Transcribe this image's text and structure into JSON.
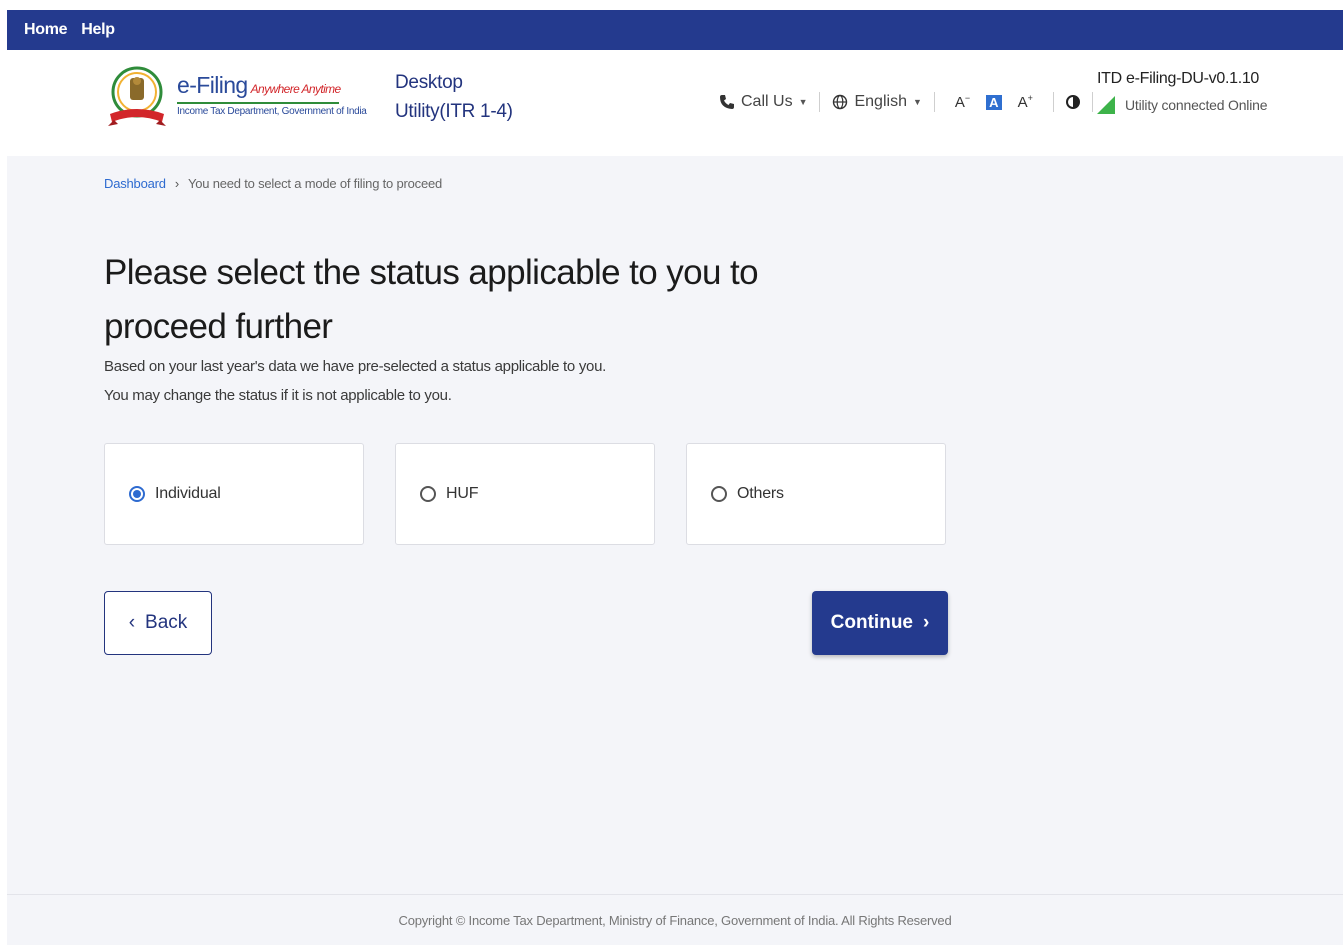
{
  "topnav": {
    "home": "Home",
    "help": "Help"
  },
  "header": {
    "logo_title": "e-Filing",
    "logo_tagline": "Anywhere Anytime",
    "logo_subtitle": "Income Tax Department, Government of India",
    "utility_line1": "Desktop",
    "utility_line2": "Utility(ITR 1-4)",
    "call_us": "Call Us",
    "language": "English",
    "font_decrease": "A",
    "font_normal": "A",
    "font_increase": "A",
    "version": "ITD e-Filing-DU-v0.1.10",
    "connection_status": "Utility connected Online"
  },
  "breadcrumb": {
    "dashboard": "Dashboard",
    "current": "You need to select a mode of filing to proceed"
  },
  "main": {
    "heading": "Please select the status applicable to you to proceed further",
    "desc_line1": "Based on your last year's data we have pre-selected a status applicable to you.",
    "desc_line2": "You may change the status if it is not applicable to you.",
    "options": [
      {
        "label": "Individual",
        "selected": true
      },
      {
        "label": "HUF",
        "selected": false
      },
      {
        "label": "Others",
        "selected": false
      }
    ],
    "back_label": "Back",
    "continue_label": "Continue"
  },
  "footer": {
    "copyright": "Copyright © Income Tax Department, Ministry of Finance, Government of India. All Rights Reserved"
  },
  "colors": {
    "brand_navy": "#243a8e",
    "link_blue": "#2e6bd0",
    "online_green": "#3db34a"
  }
}
